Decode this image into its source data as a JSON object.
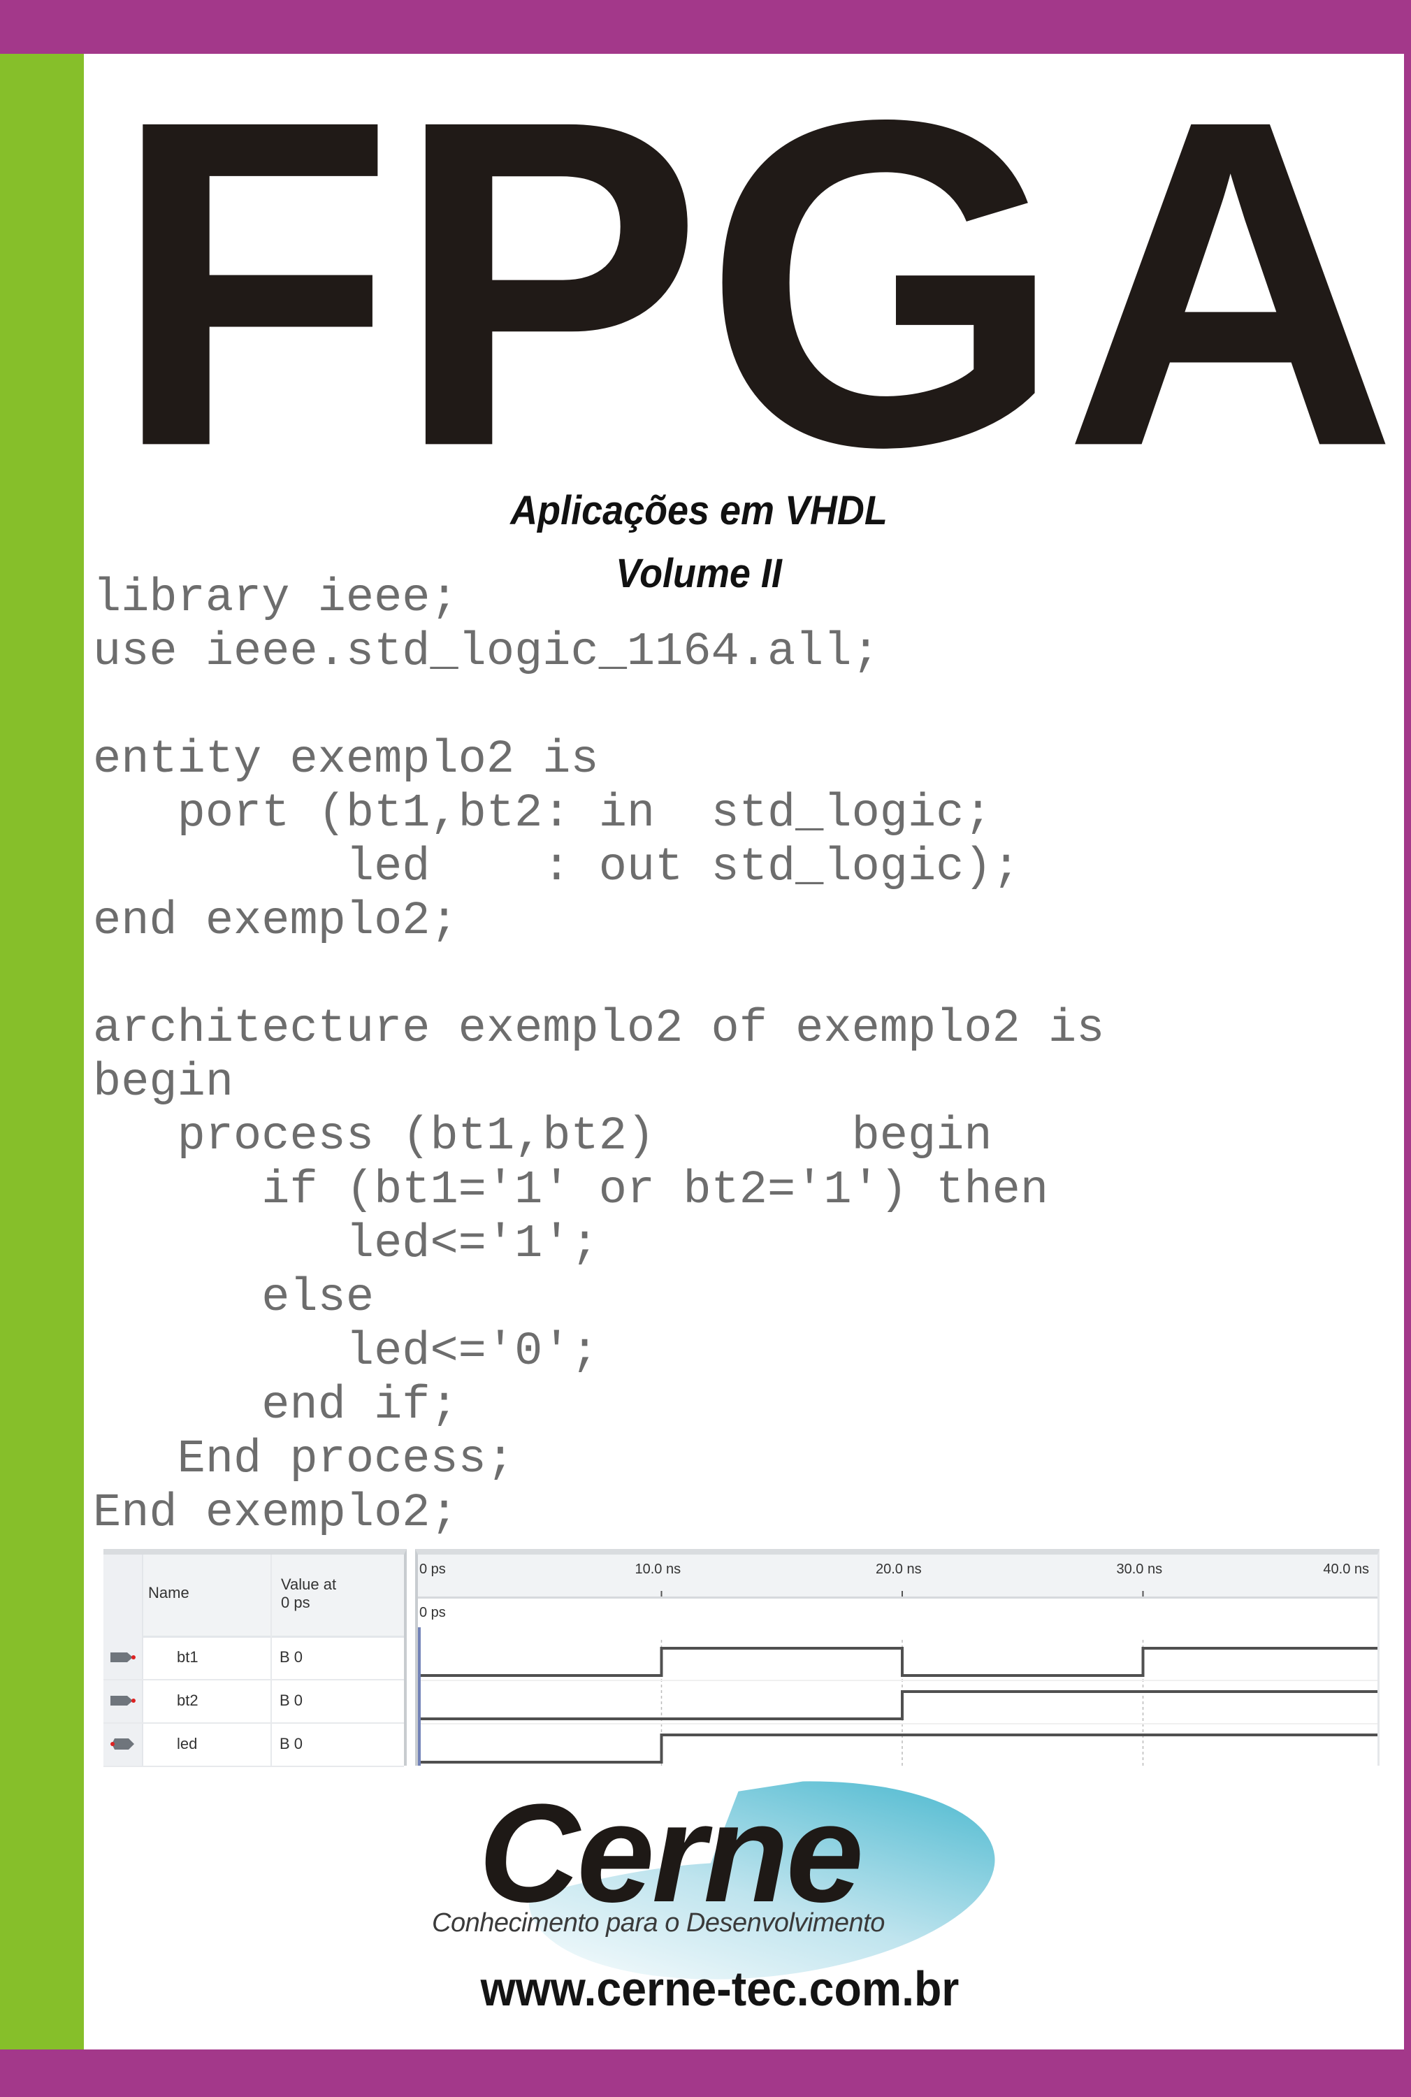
{
  "cover": {
    "title": "FPGA",
    "subtitle_line1": "Aplicações em VHDL",
    "subtitle_line2": "Volume II",
    "colors": {
      "frame_purple": "#a3388a",
      "spine_green": "#86bf2a",
      "title_black": "#201a17",
      "code_gray": "#6d6d6d",
      "logo_cyan": "#3fb4cc"
    }
  },
  "code": {
    "language": "VHDL",
    "lines": [
      "library ieee;",
      "use ieee.std_logic_1164.all;",
      "",
      "entity exemplo2 is",
      "   port (bt1,bt2: in  std_logic;",
      "         led    : out std_logic);",
      "end exemplo2;",
      "",
      "architecture exemplo2 of exemplo2 is",
      "begin",
      "   process (bt1,bt2)       begin",
      "      if (bt1='1' or bt2='1') then",
      "         led<='1';",
      "      else",
      "         led<='0';",
      "      end if;",
      "   End process;",
      "End exemplo2;"
    ]
  },
  "waveform": {
    "table": {
      "header_name": "Name",
      "header_value": "Value at\n0 ps",
      "rows": [
        {
          "icon": "input-pin-icon",
          "name": "bt1",
          "value": "B 0"
        },
        {
          "icon": "input-pin-icon",
          "name": "bt2",
          "value": "B 0"
        },
        {
          "icon": "output-pin-icon",
          "name": "led",
          "value": "B 0"
        }
      ]
    },
    "ruler": {
      "unit": "ns",
      "range_ns": [
        0,
        40
      ],
      "ticks": [
        {
          "t": 0,
          "label": "0 ps"
        },
        {
          "t": 10,
          "label": "10.0 ns"
        },
        {
          "t": 20,
          "label": "20.0 ns"
        },
        {
          "t": 30,
          "label": "30.0 ns"
        },
        {
          "t": 40,
          "label": "40.0 ns"
        }
      ],
      "cursor_label": "0 ps"
    },
    "signals": [
      {
        "name": "bt1",
        "transitions": [
          [
            0,
            0
          ],
          [
            10,
            1
          ],
          [
            20,
            0
          ],
          [
            30,
            1
          ]
        ]
      },
      {
        "name": "bt2",
        "transitions": [
          [
            0,
            0
          ],
          [
            20,
            1
          ]
        ]
      },
      {
        "name": "led",
        "transitions": [
          [
            0,
            0
          ],
          [
            10,
            1
          ]
        ]
      }
    ]
  },
  "publisher": {
    "logo_word": "Cerne",
    "tagline": "Conhecimento para o Desenvolvimento",
    "url": "www.cerne-tec.com.br"
  }
}
